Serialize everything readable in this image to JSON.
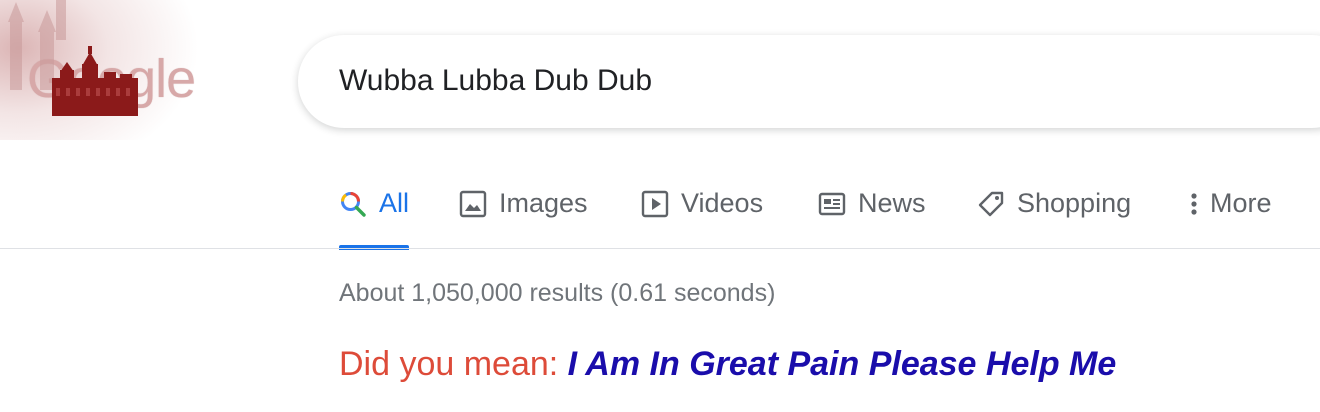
{
  "logo": {
    "text": "Google"
  },
  "search": {
    "query": "Wubba Lubba Dub Dub"
  },
  "tabs": [
    {
      "label": "All",
      "icon": "search-icon",
      "active": true
    },
    {
      "label": "Images",
      "icon": "image-icon",
      "active": false
    },
    {
      "label": "Videos",
      "icon": "play-icon",
      "active": false
    },
    {
      "label": "News",
      "icon": "news-icon",
      "active": false
    },
    {
      "label": "Shopping",
      "icon": "tag-icon",
      "active": false
    },
    {
      "label": "More",
      "icon": "more-vert-icon",
      "active": false
    }
  ],
  "results": {
    "stats": "About 1,050,000 results (0.61 seconds)",
    "did_you_mean_label": "Did you mean:",
    "did_you_mean_suggestion": "I Am In Great Pain Please Help Me"
  },
  "colors": {
    "accent": "#1a73e8",
    "suggestion_link": "#1a0dab",
    "did_you_mean_label": "#dd4b39",
    "muted_text": "#70757a"
  }
}
